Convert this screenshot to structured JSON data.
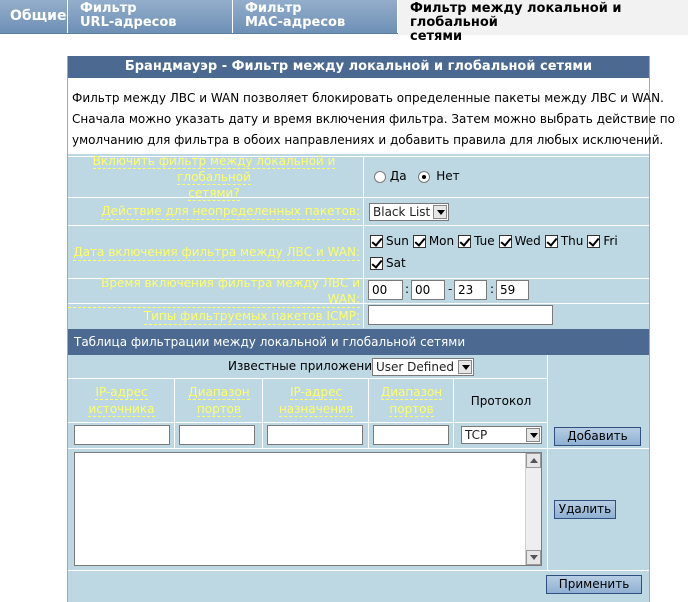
{
  "tabs": [
    {
      "line1": "Общие",
      "line2": ""
    },
    {
      "line1": "Фильтр",
      "line2": "URL-адресов"
    },
    {
      "line1": "Фильтр",
      "line2": "МАС-адресов"
    },
    {
      "line1": "Фильтр между локальной и глобальной",
      "line2": "сетями"
    }
  ],
  "panel_title": "Брандмауэр - Фильтр между локальной и глобальной сетями",
  "description": [
    "Фильтр между ЛВС и WAN позволяет блокировать определенные пакеты между ЛВС и WAN.",
    "Сначала можно указать дату и время включения фильтра. Затем можно выбрать действие по",
    "умолчанию для фильтра в обоих направлениях и добавить правила для любых исключений."
  ],
  "enable": {
    "label_line1": "Включить фильтр между локальной и глобальной",
    "label_line2": "сетями?",
    "yes": "Да",
    "no": "Нет",
    "selected": "no"
  },
  "undefined_action": {
    "label": "Действие для неопределенных пакетов:",
    "value": "Black List"
  },
  "dates": {
    "label": "Дата включения фильтра между ЛВС и WAN:",
    "days": [
      {
        "name": "Sun",
        "checked": true
      },
      {
        "name": "Mon",
        "checked": true
      },
      {
        "name": "Tue",
        "checked": true
      },
      {
        "name": "Wed",
        "checked": true
      },
      {
        "name": "Thu",
        "checked": true
      },
      {
        "name": "Fri",
        "checked": true
      },
      {
        "name": "Sat",
        "checked": true
      }
    ]
  },
  "time": {
    "label": "Время включения фильтра между ЛВС и WAN:",
    "start_h": "00",
    "start_m": "00",
    "end_h": "23",
    "end_m": "59",
    "sep_colon": ":",
    "sep_dash": "-"
  },
  "icmp": {
    "label": "Типы фильтруемых пакетов ICMP:",
    "value": ""
  },
  "filter_table": {
    "title": "Таблица фильтрации между локальной и глобальной сетями",
    "known_apps_label": "Известные приложения:",
    "known_apps_value": "User Defined",
    "col_src_ip_1": "IP-адрес",
    "col_src_ip_2": "источника",
    "col_src_port_1": "Диапазон",
    "col_src_port_2": "портов",
    "col_dst_ip_1": "IP-адрес",
    "col_dst_ip_2": "назначения",
    "col_dst_port_1": "Диапазон",
    "col_dst_port_2": "портов",
    "col_protocol": "Протокол",
    "protocol_value": "TCP",
    "add_label": "Добавить",
    "delete_label": "Удалить"
  },
  "apply_label": "Применить",
  "colors": {
    "header_bg": "#4c6a91",
    "panel_bg": "#bdd7e3",
    "label_yellow": "#ffff66"
  }
}
